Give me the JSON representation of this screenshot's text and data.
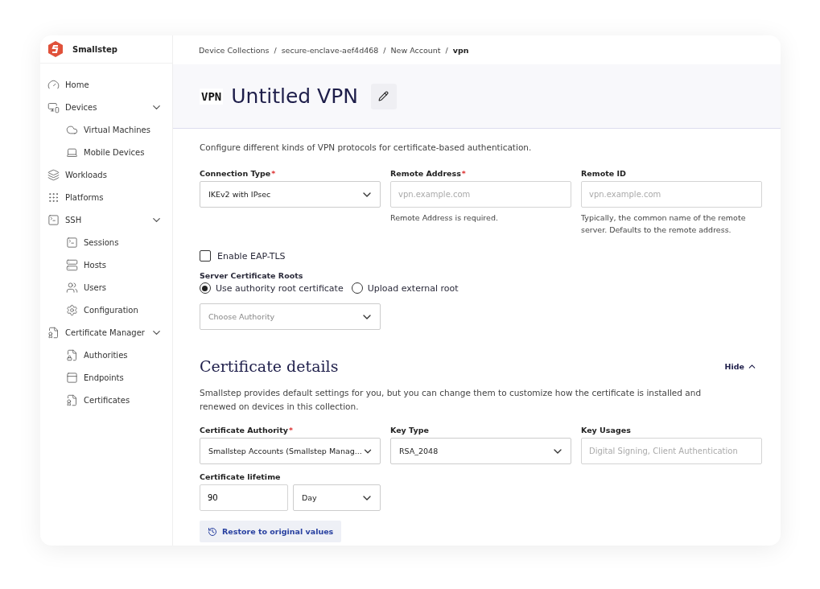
{
  "brand": {
    "name": "Smallstep"
  },
  "sidebar": {
    "items": [
      {
        "label": "Home"
      },
      {
        "label": "Devices",
        "expanded": true,
        "children": [
          {
            "label": "Virtual Machines"
          },
          {
            "label": "Mobile Devices"
          }
        ]
      },
      {
        "label": "Workloads"
      },
      {
        "label": "Platforms"
      },
      {
        "label": "SSH",
        "expanded": true,
        "children": [
          {
            "label": "Sessions"
          },
          {
            "label": "Hosts"
          },
          {
            "label": "Users"
          },
          {
            "label": "Configuration"
          }
        ]
      },
      {
        "label": "Certificate Manager",
        "expanded": true,
        "children": [
          {
            "label": "Authorities"
          },
          {
            "label": "Endpoints"
          },
          {
            "label": "Certificates"
          }
        ]
      }
    ]
  },
  "breadcrumb": [
    {
      "label": "Device Collections",
      "current": false
    },
    {
      "label": "secure-enclave-aef4d468",
      "current": false
    },
    {
      "label": "New Account",
      "current": false
    },
    {
      "label": "vpn",
      "current": true
    }
  ],
  "separator": "/",
  "header": {
    "badge": "VPN",
    "title": "Untitled VPN"
  },
  "vpn_section": {
    "description": "Configure different kinds of VPN protocols for certificate-based authentication.",
    "fields": [
      {
        "kind": "select",
        "label": "Connection Type",
        "required_mark": "*",
        "value": "IKEv2 with IPsec"
      },
      {
        "kind": "input",
        "label": "Remote Address",
        "required_mark": "*",
        "placeholder": "vpn.example.com",
        "help": "Remote Address is required."
      },
      {
        "kind": "input",
        "label": "Remote ID",
        "placeholder": "vpn.example.com",
        "help": "Typically, the common name of the remote server. Defaults to the remote address."
      }
    ],
    "checkbox": {
      "label": "Enable EAP-TLS",
      "checked": false
    },
    "roots": {
      "label": "Server Certificate Roots",
      "options": [
        {
          "label": "Use authority root certificate",
          "selected": true
        },
        {
          "label": "Upload external root",
          "selected": false
        }
      ]
    },
    "authority_select": {
      "placeholder": "Choose Authority"
    }
  },
  "cert_section": {
    "title": "Certificate details",
    "toggle": "Hide",
    "description": "Smallstep provides default settings for you, but you can change them to customize how the certificate is installed and renewed on devices in this collection.",
    "fields": [
      {
        "kind": "select",
        "label": "Certificate Authority",
        "required_mark": "*",
        "value": "Smallstep Accounts (Smallstep Manag..."
      },
      {
        "kind": "select",
        "label": "Key Type",
        "value": "RSA_2048"
      },
      {
        "kind": "input",
        "label": "Key Usages",
        "placeholder": "Digital Signing, Client Authentication"
      }
    ],
    "lifetime": {
      "label": "Certificate lifetime",
      "value": "90",
      "unit": "Day"
    },
    "restore_button": "Restore to original values"
  }
}
